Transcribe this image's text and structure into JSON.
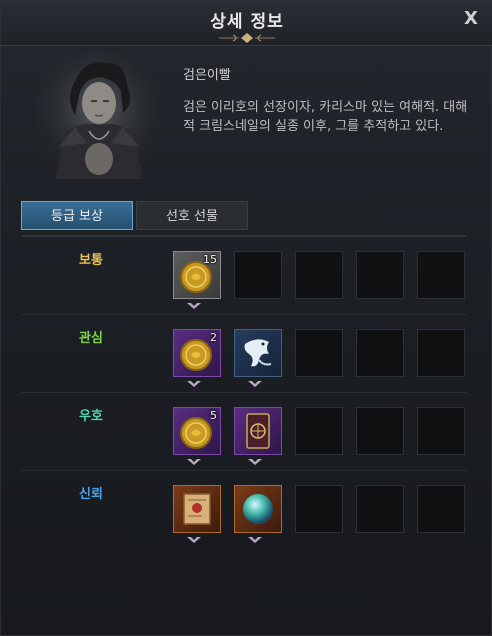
{
  "window": {
    "title": "상세 정보",
    "close_label": "X"
  },
  "character": {
    "name": "검은이빨",
    "description": "검은 이리호의 선장이자, 카리스마 있는 여해적. 대해적 크림스네일의 실종 이후, 그를 추적하고 있다."
  },
  "tabs": [
    {
      "label": "등급 보상",
      "active": true
    },
    {
      "label": "선호 선물",
      "active": false
    }
  ],
  "tiers": [
    {
      "label": "보통",
      "color": "#e7c35a",
      "rewards": [
        {
          "icon": "gold-coin-icon",
          "quantity": "15",
          "rarity": "gray"
        }
      ]
    },
    {
      "label": "관심",
      "color": "#7fd34a",
      "rewards": [
        {
          "icon": "gold-coin-icon",
          "quantity": "2",
          "rarity": "purple"
        },
        {
          "icon": "eagle-emblem-icon",
          "quantity": "",
          "rarity": "blue"
        }
      ]
    },
    {
      "label": "우호",
      "color": "#4fd3b0",
      "rewards": [
        {
          "icon": "gold-coin-icon",
          "quantity": "5",
          "rarity": "purple"
        },
        {
          "icon": "tarot-card-icon",
          "quantity": "",
          "rarity": "purple"
        }
      ]
    },
    {
      "label": "신뢰",
      "color": "#4aa3e8",
      "rewards": [
        {
          "icon": "treasure-map-icon",
          "quantity": "",
          "rarity": "orange"
        },
        {
          "icon": "crystal-orb-icon",
          "quantity": "",
          "rarity": "orange"
        }
      ]
    }
  ],
  "colors": {
    "accent": "#3a6f97",
    "background": "#1b1e23"
  }
}
